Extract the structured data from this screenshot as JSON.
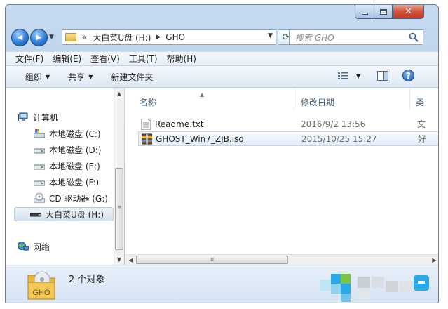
{
  "window": {
    "caption": {
      "minimize_glyph": "—",
      "close_glyph": "✕"
    }
  },
  "navigation": {
    "back_glyph": "◀",
    "forward_glyph": "▶",
    "address": {
      "chevrons": "«",
      "segments": [
        "大白菜U盘 (H:)",
        "GHO"
      ],
      "separator": "▶"
    },
    "refresh_glyph": "⟳",
    "search": {
      "placeholder": "搜索 GHO"
    }
  },
  "menubar": {
    "items": [
      "文件(F)",
      "编辑(E)",
      "查看(V)",
      "工具(T)",
      "帮助(H)"
    ]
  },
  "commandbar": {
    "organize": "组织",
    "share": "共享",
    "new_folder": "新建文件夹",
    "help_glyph": "?"
  },
  "navpane": {
    "items": [
      {
        "label": "计算机",
        "icon": "computer-icon"
      },
      {
        "label": "本地磁盘 (C:)",
        "icon": "system-drive-icon"
      },
      {
        "label": "本地磁盘 (D:)",
        "icon": "drive-icon"
      },
      {
        "label": "本地磁盘 (E:)",
        "icon": "drive-icon"
      },
      {
        "label": "本地磁盘 (F:)",
        "icon": "drive-icon"
      },
      {
        "label": "CD 驱动器 (G:)",
        "icon": "cd-drive-icon"
      },
      {
        "label": "大白菜U盘 (H:)",
        "icon": "usb-drive-icon",
        "selected": true
      },
      {
        "label": "网络",
        "icon": "network-icon"
      }
    ]
  },
  "filelist": {
    "columns": {
      "name": "名称",
      "modified": "修改日期",
      "type": "类"
    },
    "rows": [
      {
        "name": "Readme.txt",
        "modified": "2016/9/2 13:56",
        "type": "文",
        "icon": "text-file-icon",
        "selected": false
      },
      {
        "name": "GHOST_Win7_ZJB.iso",
        "modified": "2015/10/25 15:27",
        "type": "好",
        "icon": "iso-archive-icon",
        "selected": true
      }
    ],
    "scroll_thumb_glyph": "Ⅲ"
  },
  "details": {
    "icon_label": "GHO",
    "status": "2 个对象"
  },
  "colors": {
    "frame": "#b4cbe6",
    "close_red": "#d2523a",
    "selection": "#e4eefb",
    "watermark_blue": "#2aa9e8",
    "watermark_green": "#7cc243"
  }
}
